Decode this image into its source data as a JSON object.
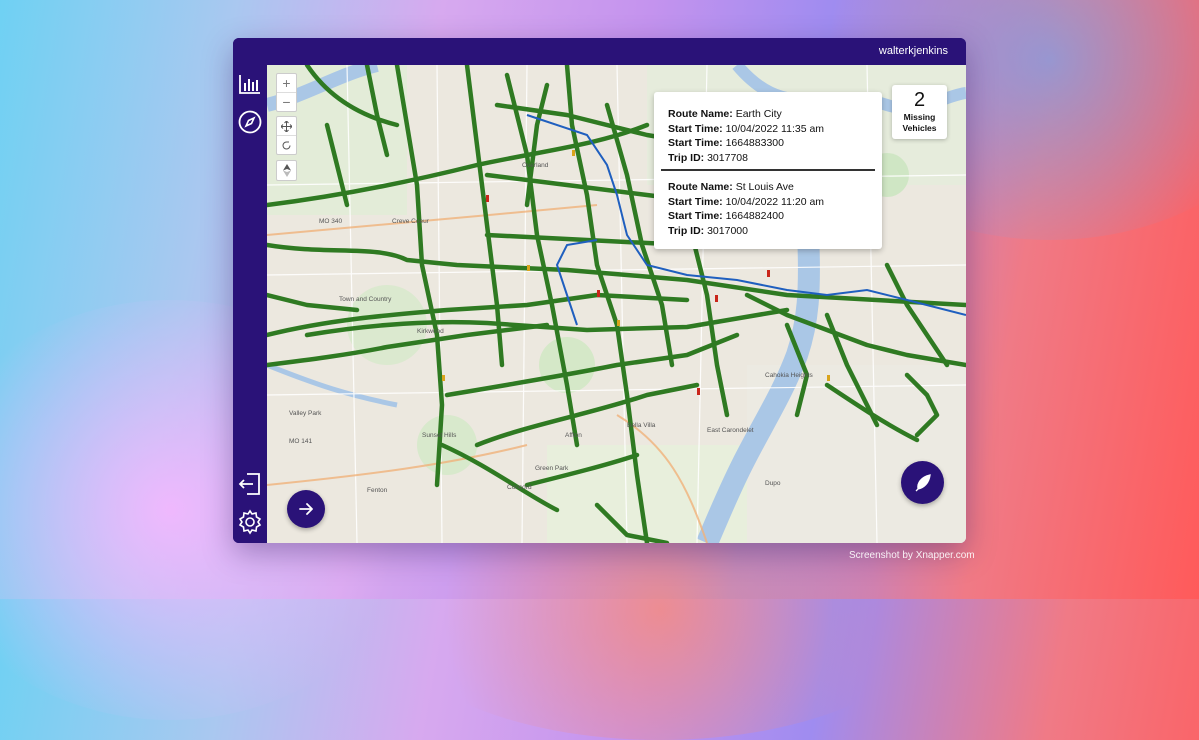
{
  "header": {
    "username": "walterkjenkins"
  },
  "sidebar": {
    "items": [
      {
        "icon": "bar-chart-icon"
      },
      {
        "icon": "compass-icon"
      },
      {
        "icon": "logout-icon"
      },
      {
        "icon": "settings-icon"
      }
    ]
  },
  "map_controls": {
    "zoom_in": "+",
    "zoom_out": "−"
  },
  "popup": {
    "trips": [
      {
        "route_label": "Route Name:",
        "route": "Earth City",
        "start_label": "Start Time:",
        "start_time": "10/04/2022 11:35 am",
        "start_label2": "Start Time:",
        "start_epoch": "1664883300",
        "trip_label": "Trip ID:",
        "trip_id": "3017708"
      },
      {
        "route_label": "Route Name:",
        "route": "St Louis Ave",
        "start_label": "Start Time:",
        "start_time": "10/04/2022 11:20 am",
        "start_label2": "Start Time:",
        "start_epoch": "1664882400",
        "trip_label": "Trip ID:",
        "trip_id": "3017000"
      }
    ]
  },
  "missing_vehicles": {
    "count": "2",
    "label_line1": "Missing",
    "label_line2": "Vehicles"
  },
  "map_labels": {
    "overland": "Overland",
    "creve_coeur": "Creve Coeur",
    "town_country": "Town and Country",
    "kirkwood": "Kirkwood",
    "affton": "Affton",
    "concord": "Concord",
    "sunset_hills": "Sunset Hills",
    "fenton": "Fenton",
    "bella_villa": "Bella Villa",
    "cahokia": "Cahokia Heights",
    "east_carondelet": "East Carondelet",
    "dupo": "Dupo",
    "mo340": "MO 340",
    "mo141": "MO 141",
    "valley_park": "Valley Park",
    "green_park": "Green Park"
  },
  "colors": {
    "brand": "#2a1278",
    "route": "#2f7a22",
    "highlight": "#1f5fbf",
    "river": "#aac7e6"
  },
  "credit": "Screenshot by Xnapper.com"
}
